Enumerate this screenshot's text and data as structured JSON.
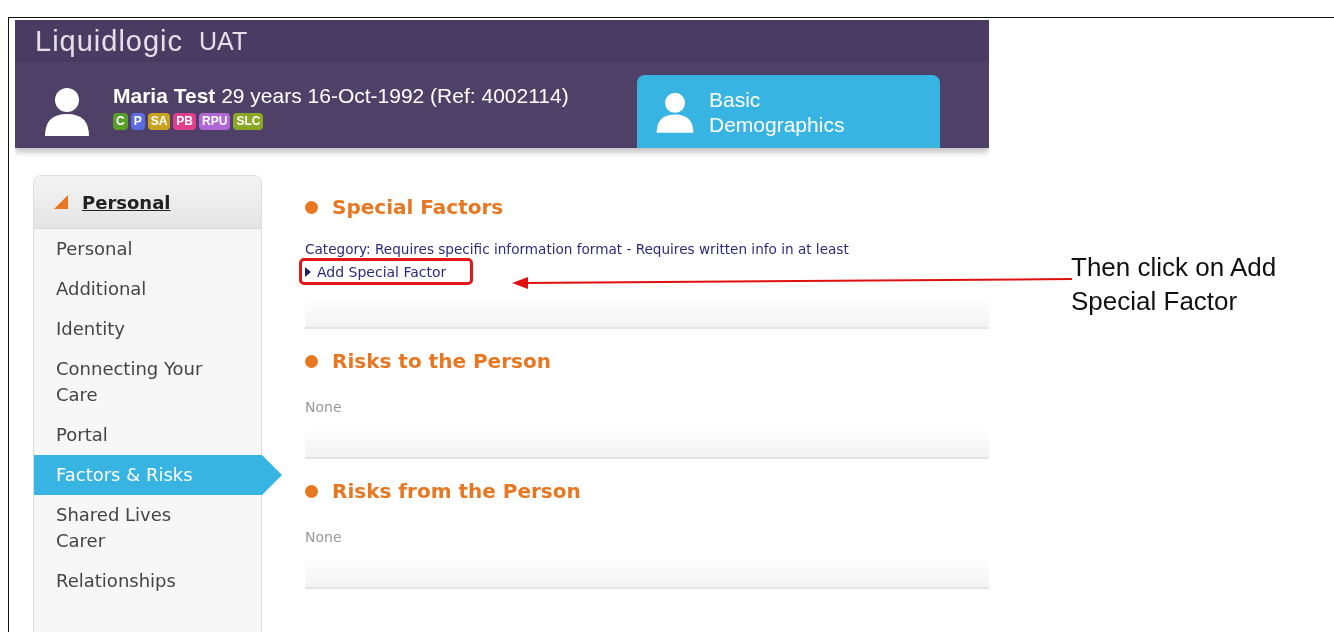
{
  "app": {
    "logo": "Liquidlogic",
    "environment": "UAT"
  },
  "patient": {
    "name": "Maria Test",
    "details": "29 years 16-Oct-1992 (Ref: 4002114)",
    "badges": [
      {
        "label": "C",
        "color": "#5a9e2a"
      },
      {
        "label": "P",
        "color": "#5b6de0"
      },
      {
        "label": "SA",
        "color": "#c8a21e"
      },
      {
        "label": "PB",
        "color": "#df3f8c"
      },
      {
        "label": "RPU",
        "color": "#b066d4"
      },
      {
        "label": "SLC",
        "color": "#8aa826"
      }
    ]
  },
  "tabs": [
    {
      "label": "Basic Demographics",
      "selected": true
    }
  ],
  "sidebar": {
    "heading": "Personal",
    "expanded": true,
    "items": [
      {
        "label": "Personal",
        "selected": false
      },
      {
        "label": "Additional",
        "selected": false
      },
      {
        "label": "Identity",
        "selected": false
      },
      {
        "label": "Connecting Your Care",
        "selected": false
      },
      {
        "label": "Portal",
        "selected": false
      },
      {
        "label": "Factors & Risks",
        "selected": true
      },
      {
        "label": "Shared Lives Carer",
        "selected": false
      },
      {
        "label": "Relationships",
        "selected": false
      }
    ]
  },
  "sections": [
    {
      "title": "Special Factors",
      "text": "Category: Requires specific information format - Requires written info in at least",
      "action": "Add Special Factor"
    },
    {
      "title": "Risks to the Person",
      "empty_text": "None"
    },
    {
      "title": "Risks from the Person",
      "empty_text": "None"
    }
  ],
  "annotation": {
    "text": "Then click on Add Special Factor"
  }
}
